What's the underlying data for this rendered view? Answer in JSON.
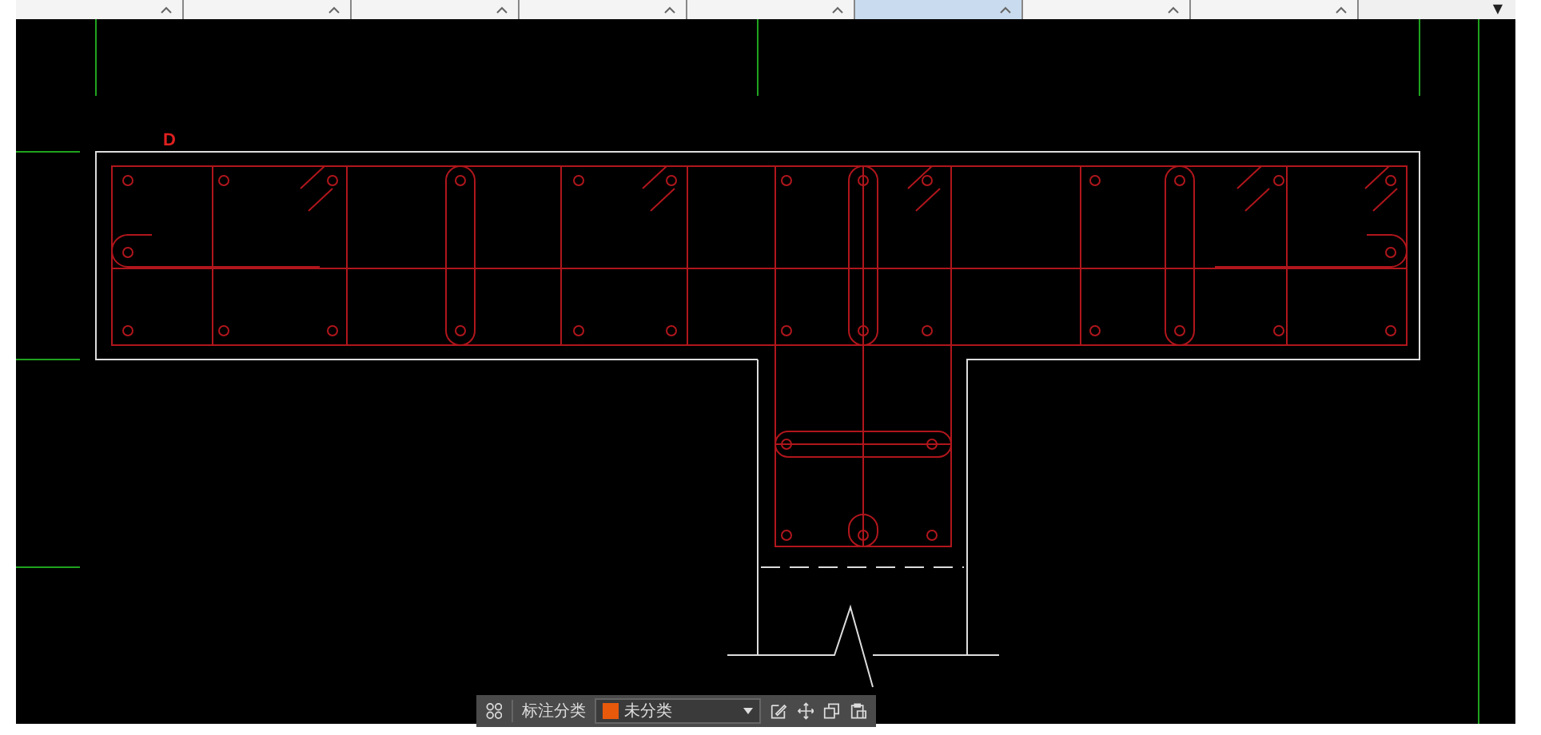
{
  "tabs": [
    {
      "selected": false
    },
    {
      "selected": false
    },
    {
      "selected": false
    },
    {
      "selected": false
    },
    {
      "selected": false
    },
    {
      "selected": true
    },
    {
      "selected": false
    },
    {
      "selected": false
    }
  ],
  "tab_menu": {
    "caret": "▼"
  },
  "drawing": {
    "axis_label": "D"
  },
  "toolbar": {
    "label": "标注分类",
    "category": {
      "text": "未分类",
      "color": "#e8590c"
    }
  }
}
